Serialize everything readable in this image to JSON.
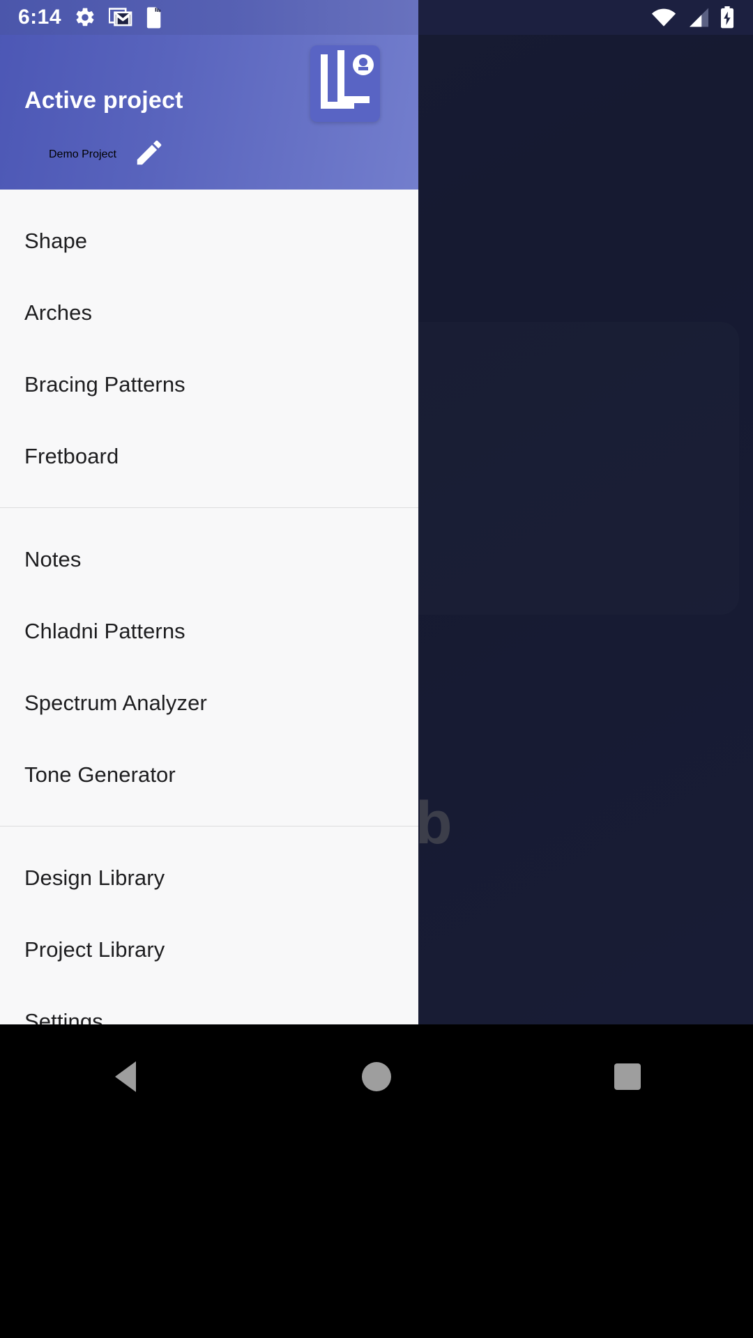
{
  "status_bar": {
    "time": "6:14",
    "left_icons": [
      "gear-icon",
      "gmail-icon",
      "sd-card-icon"
    ],
    "right_icons": [
      "wifi-icon",
      "cell-signal-icon",
      "battery-charging-icon"
    ],
    "background_color": "#1c2040",
    "tint_color": "#5964bd"
  },
  "drawer": {
    "header": {
      "title": "Active project",
      "project_name": "Demo Project",
      "edit_icon": "pencil-icon",
      "logo_icon": "app-logo-icon",
      "gradient_from": "#4c57b5",
      "gradient_to": "#737ecd"
    },
    "sections": [
      {
        "items": [
          {
            "label": "Shape"
          },
          {
            "label": "Arches"
          },
          {
            "label": "Bracing Patterns"
          },
          {
            "label": "Fretboard"
          }
        ]
      },
      {
        "items": [
          {
            "label": "Notes"
          },
          {
            "label": "Chladni Patterns"
          },
          {
            "label": "Spectrum Analyzer"
          },
          {
            "label": "Tone Generator"
          }
        ]
      },
      {
        "items": [
          {
            "label": "Design Library"
          },
          {
            "label": "Project Library"
          },
          {
            "label": "Settings"
          }
        ]
      }
    ],
    "background_color": "#f8f8f9",
    "text_color": "#1d1d1f",
    "divider_color": "#dcdcdd"
  },
  "background_app": {
    "visible_letter": "b",
    "scrim_color": "rgba(10,12,28,0.55)",
    "base_color": "#262b4c"
  },
  "nav_bar": {
    "buttons": [
      {
        "name": "back-button",
        "icon": "triangle-back-icon"
      },
      {
        "name": "home-button",
        "icon": "circle-home-icon"
      },
      {
        "name": "recents-button",
        "icon": "square-recents-icon"
      }
    ],
    "background_color": "#000000",
    "icon_color": "#9e9e9e"
  }
}
